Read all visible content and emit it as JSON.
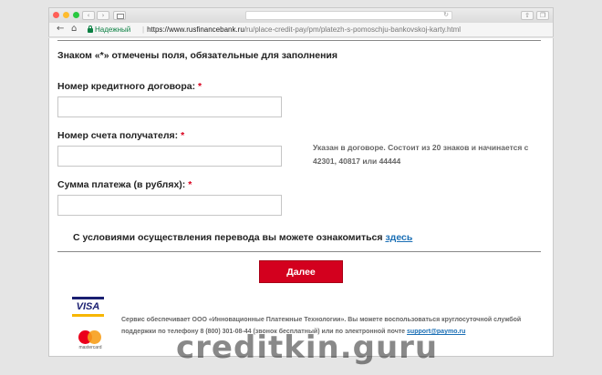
{
  "browser": {
    "secure_label": "Надежный",
    "url_host": "https://www.rusfinancebank.ru",
    "url_path": "/ru/place-credit-pay/pm/platezh-s-pomoschju-bankovskoj-karty.html"
  },
  "form": {
    "required_note": "Знаком «*» отмечены поля, обязательные для заполнения",
    "contract_label": "Номер кредитного договора:",
    "account_label": "Номер счета получателя:",
    "amount_label": "Сумма платежа (в рублях):",
    "asterisk": "*",
    "contract_value": "",
    "account_value": "",
    "amount_value": "",
    "account_hint": "Указан в договоре. Состоит из 20 знаков и начинается с 42301, 40817 или 44444",
    "terms_text": "С условиями осуществления перевода вы можете ознакомиться ",
    "terms_link": "здесь",
    "submit_label": "Далее"
  },
  "footer": {
    "visa_label": "VISA",
    "mastercard_label": "mastercard",
    "service_text": "Сервис обеспечивает ООО «Инновационные Платежные Технологии». Вы можете воспользоваться круглосуточной службой поддержки по телефону 8 (800) 301-08-44 (звонок бесплатный) или по электронной почте ",
    "support_email": "support@paymo.ru"
  },
  "watermark": "creditkin.guru",
  "colors": {
    "accent_red": "#d3001e",
    "link_blue": "#1b6fb5",
    "secure_green": "#0b8043"
  }
}
